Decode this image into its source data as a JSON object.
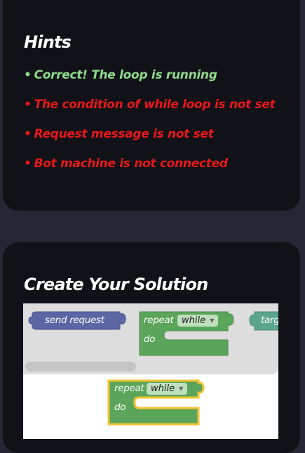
{
  "hints": {
    "title": "Hints",
    "bullet": "•",
    "items": [
      {
        "text": "Correct! The loop is running",
        "status": "success",
        "color": "#8fd98c"
      },
      {
        "text": "The condition of while loop is not set",
        "status": "error",
        "color": "#e8181b"
      },
      {
        "text": "Request message is not set",
        "status": "error",
        "color": "#e8181b"
      },
      {
        "text": "Bot machine is not connected",
        "status": "error",
        "color": "#e8181b"
      }
    ]
  },
  "solution": {
    "title": "Create Your Solution",
    "flyout": {
      "send_request_label": "send request",
      "repeat_label": "repeat",
      "repeat_mode": "while",
      "do_label": "do",
      "target_label": "targ"
    },
    "canvas": {
      "repeat_label": "repeat",
      "repeat_mode": "while",
      "do_label": "do"
    }
  },
  "colors": {
    "send_request_block": "#5b67a5",
    "loop_block": "#5ba55b",
    "target_block": "#5ba58c",
    "selected_outline": "#f3c332",
    "background": "#262735",
    "card": "#111217"
  }
}
